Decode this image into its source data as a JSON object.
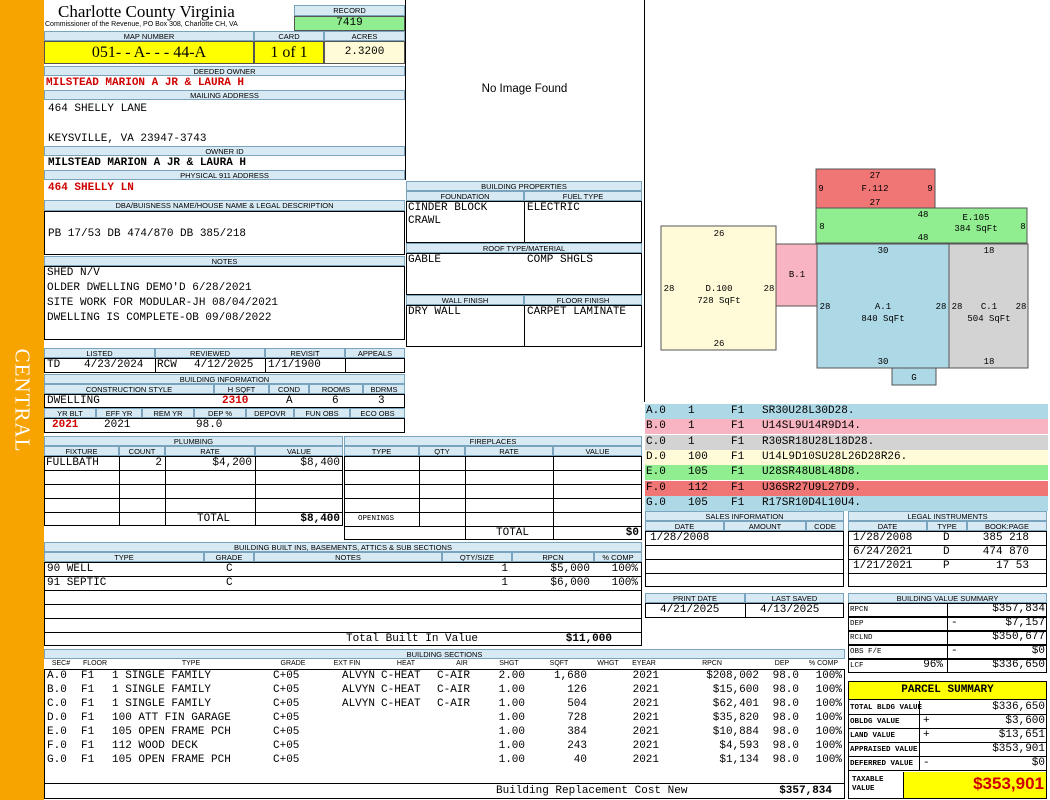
{
  "sidebar": {
    "label": "CENTRAL"
  },
  "header": {
    "county": "Charlotte County Virginia",
    "subtitle": "Commissioner of the Revenue, PO Box 308, Charlotte CH, VA",
    "record_label": "RECORD",
    "record_value": "7419"
  },
  "parcel": {
    "map_number_label": "MAP NUMBER",
    "map_number": "051- - A- - - 44-A",
    "card_label": "CARD",
    "card": "1 of 1",
    "acres_label": "ACRES",
    "acres": "2.3200"
  },
  "owner": {
    "deeded_owner_label": "DEEDED OWNER",
    "deeded_owner": "MILSTEAD MARION A JR & LAURA H",
    "mailing_address_label": "MAILING ADDRESS",
    "address_line1": "464 SHELLY LANE",
    "address_line2": "KEYSVILLE, VA 23947-3743",
    "owner_id_label": "OWNER ID",
    "owner_id": "MILSTEAD MARION A JR & LAURA H",
    "physical_address_label": "PHYSICAL 911 ADDRESS",
    "physical_address": "464 SHELLY LN"
  },
  "legal": {
    "label": "DBA/BUISNESS NAME/HOUSE NAME & LEGAL DESCRIPTION",
    "text": "PB 17/53 DB 474/870 DB 385/218"
  },
  "notes": {
    "label": "NOTES",
    "lines": [
      "SHED N/V",
      "OLDER DWELLING DEMO'D 6/28/2021",
      "SITE WORK FOR MODULAR-JH 08/04/2021",
      "DWELLING IS COMPLETE-OB 09/08/2022"
    ]
  },
  "review": {
    "listed_label": "LISTED",
    "reviewed_label": "REVIEWED",
    "revisit_label": "REVISIT",
    "appeals_label": "APPEALS",
    "listed_by": "TD",
    "listed_date": "4/23/2024",
    "reviewed_by": "RCW",
    "reviewed_date": "4/12/2025",
    "revisit": "1/1/1900",
    "appeals": ""
  },
  "building_info": {
    "label": "BUILDING INFORMATION",
    "construction_label": "CONSTRUCTION STYLE",
    "hsqft_label": "H SQFT",
    "cond_label": "COND",
    "rooms_label": "ROOMS",
    "bdrms_label": "BDRMS",
    "construction": "DWELLING",
    "hsqft": "2310",
    "cond": "A",
    "rooms": "6",
    "bdrms": "3",
    "yrblt_label": "YR BLT",
    "effyr_label": "EFF YR",
    "remyr_label": "REM YR",
    "dep_label": "DEP %",
    "depovr_label": "DEPOVR",
    "funobs_label": "FUN OBS",
    "ecoobs_label": "ECO OBS",
    "yrblt": "2021",
    "effyr": "2021",
    "remyr": "",
    "dep": "98.0"
  },
  "image": {
    "placeholder": "No Image Found"
  },
  "building_properties": {
    "label": "BUILDING PROPERTIES",
    "foundation_label": "FOUNDATION",
    "fuel_label": "FUEL TYPE",
    "foundation": "CINDER BLOCK CRAWL",
    "fuel": "ELECTRIC",
    "roof_label": "ROOF TYPE/MATERIAL",
    "roof_type": "GABLE",
    "roof_material": "COMP SHGLS",
    "wall_label": "WALL FINISH",
    "floor_label": "FLOOR FINISH",
    "wall": "DRY WALL",
    "floor": "CARPET LAMINATE"
  },
  "sketch": {
    "shapes": [
      {
        "id": "F",
        "title": "F.112",
        "top": "27",
        "bottom": "27",
        "left": "9",
        "right": "9"
      },
      {
        "id": "E",
        "title": "E.105",
        "sub": "384 SqFt",
        "top": "48",
        "bottom": "48",
        "left": "8",
        "right": "8"
      },
      {
        "id": "D",
        "title": "D.100",
        "sub": "728 SqFt",
        "top": "26",
        "bottom": "26",
        "left": "28",
        "right": "28"
      },
      {
        "id": "B",
        "title": "B.1"
      },
      {
        "id": "A",
        "title": "A.1",
        "sub": "840 SqFt",
        "top": "30",
        "bottom": "30",
        "left": "28",
        "right": "28"
      },
      {
        "id": "C",
        "title": "C.1",
        "sub": "504 SqFt",
        "top": "18",
        "bottom": "18",
        "left": "28",
        "right": "28"
      },
      {
        "id": "G",
        "title": "G"
      }
    ],
    "colors": {
      "A": "#add8e6",
      "B": "#f8b4c0",
      "C": "#d3d3d3",
      "D": "#fffbd8",
      "E": "#90ee90",
      "F": "#f07575",
      "G": "#add8e6"
    }
  },
  "vectors": [
    {
      "sec": "A.0",
      "code": "1",
      "floor": "F1",
      "path": "SR30U28L30D28.",
      "color": "#add8e6"
    },
    {
      "sec": "B.0",
      "code": "1",
      "floor": "F1",
      "path": "U14SL9U14R9D14.",
      "color": "#f8b4c0"
    },
    {
      "sec": "C.0",
      "code": "1",
      "floor": "F1",
      "path": "R30SR18U28L18D28.",
      "color": "#d3d3d3"
    },
    {
      "sec": "D.0",
      "code": "100",
      "floor": "F1",
      "path": "U14L9D10SU28L26D28R26.",
      "color": "#fffbd8"
    },
    {
      "sec": "E.0",
      "code": "105",
      "floor": "F1",
      "path": "U28SR48U8L48D8.",
      "color": "#90ee90"
    },
    {
      "sec": "F.0",
      "code": "112",
      "floor": "F1",
      "path": "U36SR27U9L27D9.",
      "color": "#f07575"
    },
    {
      "sec": "G.0",
      "code": "105",
      "floor": "F1",
      "path": "R17SR10D4L10U4.",
      "color": "#add8e6"
    }
  ],
  "plumbing": {
    "label": "PLUMBING",
    "headers": [
      "FIXTURE",
      "COUNT",
      "RATE",
      "VALUE"
    ],
    "rows": [
      {
        "fixture": "FULLBATH",
        "count": "2",
        "rate": "$4,200",
        "value": "$8,400"
      }
    ],
    "total_label": "TOTAL",
    "total": "$8,400"
  },
  "fireplaces": {
    "label": "FIREPLACES",
    "headers": [
      "TYPE",
      "QTY",
      "RATE",
      "VALUE"
    ],
    "openings_label": "OPENINGS",
    "total_label": "TOTAL",
    "total": "$0"
  },
  "sales": {
    "label": "SALES INFORMATION",
    "headers": [
      "DATE",
      "AMOUNT",
      "CODE"
    ],
    "rows": [
      {
        "date": "1/28/2008",
        "amount": "",
        "code": ""
      }
    ]
  },
  "legal_instruments": {
    "label": "LEGAL INSTRUMENTS",
    "headers": [
      "DATE",
      "TYPE",
      "BOOK:PAGE"
    ],
    "rows": [
      {
        "date": "1/28/2008",
        "type": "D",
        "book": "385 218"
      },
      {
        "date": "6/24/2021",
        "type": "D",
        "book": "474 870"
      },
      {
        "date": "1/21/2021",
        "type": "P",
        "book": "17 53"
      }
    ]
  },
  "print": {
    "print_label": "PRINT DATE",
    "saved_label": "LAST SAVED",
    "print_date": "4/21/2025",
    "last_saved": "4/13/2025"
  },
  "value_summary": {
    "label": "BUILDING VALUE SUMMARY",
    "rows": [
      {
        "label": "RPCN",
        "sign": "",
        "value": "$357,834"
      },
      {
        "label": "DEP",
        "sign": "-",
        "value": "$7,157"
      },
      {
        "label": "RCLND",
        "sign": "",
        "value": "$350,677"
      },
      {
        "label": "OBS F/E",
        "sign": "-",
        "value": "$0"
      },
      {
        "label": "LCF",
        "sign": "96%",
        "value": "$336,650"
      }
    ]
  },
  "parcel_summary": {
    "title": "PARCEL SUMMARY",
    "rows": [
      {
        "label": "TOTAL BLDG VALUE",
        "sign": "",
        "value": "$336,650"
      },
      {
        "label": "OBLDG VALUE",
        "sign": "+",
        "value": "$3,600"
      },
      {
        "label": "LAND VALUE",
        "sign": "+",
        "value": "$13,651"
      },
      {
        "label": "APPRAISED VALUE",
        "sign": "",
        "value": "$353,901"
      },
      {
        "label": "DEFERRED VALUE",
        "sign": "-",
        "value": "$0"
      }
    ],
    "taxable_label": "TAXABLE VALUE",
    "taxable": "$353,901"
  },
  "builtins": {
    "label": "BUILDING BUILT INS, BASEMENTS, ATTICS & SUB SECTIONS",
    "headers": [
      "TYPE",
      "GRADE",
      "NOTES",
      "QTY/SIZE",
      "RPCN",
      "% COMP"
    ],
    "rows": [
      {
        "type": "90 WELL",
        "grade": "C",
        "notes": "",
        "qty": "1",
        "rpcn": "$5,000",
        "comp": "100%"
      },
      {
        "type": "91 SEPTIC",
        "grade": "C",
        "notes": "",
        "qty": "1",
        "rpcn": "$6,000",
        "comp": "100%"
      }
    ],
    "total_label": "Total Built In Value",
    "total": "$11,000"
  },
  "sections": {
    "label": "BUILDING SECTIONS",
    "headers": [
      "SEC#",
      "FLOOR",
      "TYPE",
      "GRADE",
      "EXT FIN",
      "HEAT",
      "AIR",
      "SHGT",
      "SQFT",
      "WHGT",
      "EYEAR",
      "RPCN",
      "DEP",
      "% COMP"
    ],
    "rows": [
      {
        "sec": "A.0",
        "floor": "F1",
        "type": "1 SINGLE FAMILY",
        "grade": "C+05",
        "ext": "ALVYN",
        "heat": "C-HEAT",
        "air": "C-AIR",
        "shgt": "2.00",
        "sqft": "1,680",
        "whgt": "",
        "eyear": "2021",
        "rpcn": "$208,002",
        "dep": "98.0",
        "comp": "100%"
      },
      {
        "sec": "B.0",
        "floor": "F1",
        "type": "1 SINGLE FAMILY",
        "grade": "C+05",
        "ext": "ALVYN",
        "heat": "C-HEAT",
        "air": "C-AIR",
        "shgt": "1.00",
        "sqft": "126",
        "whgt": "",
        "eyear": "2021",
        "rpcn": "$15,600",
        "dep": "98.0",
        "comp": "100%"
      },
      {
        "sec": "C.0",
        "floor": "F1",
        "type": "1 SINGLE FAMILY",
        "grade": "C+05",
        "ext": "ALVYN",
        "heat": "C-HEAT",
        "air": "C-AIR",
        "shgt": "1.00",
        "sqft": "504",
        "whgt": "",
        "eyear": "2021",
        "rpcn": "$62,401",
        "dep": "98.0",
        "comp": "100%"
      },
      {
        "sec": "D.0",
        "floor": "F1",
        "type": "100 ATT FIN GARAGE",
        "grade": "C+05",
        "ext": "",
        "heat": "",
        "air": "",
        "shgt": "1.00",
        "sqft": "728",
        "whgt": "",
        "eyear": "2021",
        "rpcn": "$35,820",
        "dep": "98.0",
        "comp": "100%"
      },
      {
        "sec": "E.0",
        "floor": "F1",
        "type": "105 OPEN FRAME PCH",
        "grade": "C+05",
        "ext": "",
        "heat": "",
        "air": "",
        "shgt": "1.00",
        "sqft": "384",
        "whgt": "",
        "eyear": "2021",
        "rpcn": "$10,884",
        "dep": "98.0",
        "comp": "100%"
      },
      {
        "sec": "F.0",
        "floor": "F1",
        "type": "112 WOOD DECK",
        "grade": "C+05",
        "ext": "",
        "heat": "",
        "air": "",
        "shgt": "1.00",
        "sqft": "243",
        "whgt": "",
        "eyear": "2021",
        "rpcn": "$4,593",
        "dep": "98.0",
        "comp": "100%"
      },
      {
        "sec": "G.0",
        "floor": "F1",
        "type": "105 OPEN FRAME PCH",
        "grade": "C+05",
        "ext": "",
        "heat": "",
        "air": "",
        "shgt": "1.00",
        "sqft": "40",
        "whgt": "",
        "eyear": "2021",
        "rpcn": "$1,134",
        "dep": "98.0",
        "comp": "100%"
      }
    ],
    "total_label": "Building Replacement Cost New",
    "total": "$357,834"
  }
}
